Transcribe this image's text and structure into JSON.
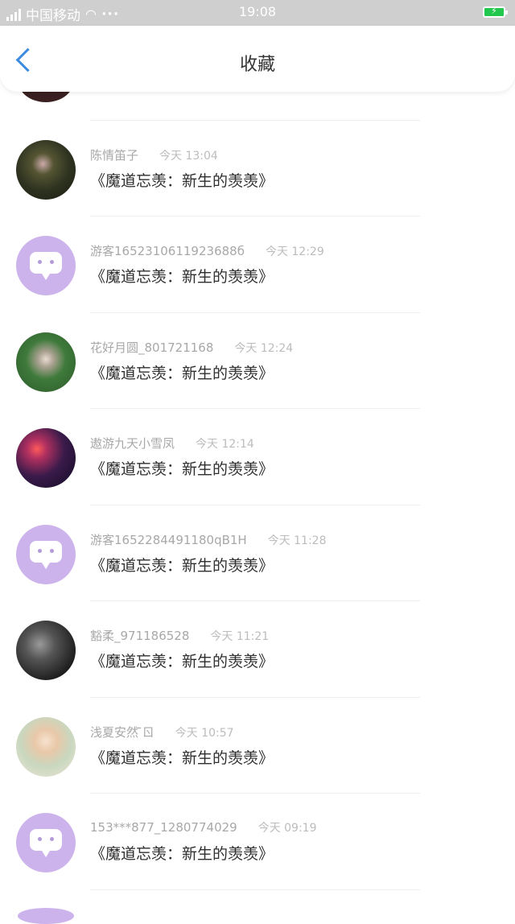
{
  "status_bar": {
    "carrier": "中国移动",
    "time": "19:08",
    "dots": "···",
    "battery_color": "#22c84d"
  },
  "nav": {
    "title": "收藏",
    "back_icon": "chevron-left-icon",
    "accent_color": "#3d8be0"
  },
  "items": [
    {
      "name": "陈情笛子",
      "time": "今天 13:04",
      "message": "《魔道忘羡：新生的羡羡》",
      "avatar": "photo1"
    },
    {
      "name": "游客1652310611923688б",
      "time": "今天 12:29",
      "message": "《魔道忘羡：新生的羡羡》",
      "avatar": "guest"
    },
    {
      "name": "花好月圆_801721168",
      "time": "今天 12:24",
      "message": "《魔道忘羡：新生的羡羡》",
      "avatar": "photo2"
    },
    {
      "name": "遨游九天小雪凤",
      "time": "今天 12:14",
      "message": "《魔道忘羡：新生的羡羡》",
      "avatar": "photo3"
    },
    {
      "name": "游客1652284491180qB1H",
      "time": "今天 11:28",
      "message": "《魔道忘羡：新生的羡羡》",
      "avatar": "guest"
    },
    {
      "name": "豁柔_971186528",
      "time": "今天 11:21",
      "message": "《魔道忘羡：新生的羡羡》",
      "avatar": "photo4"
    },
    {
      "name": "浅夏安然 ̄ㄖ",
      "time": "今天 10:57",
      "message": "《魔道忘羡：新生的羡羡》",
      "avatar": "photo5"
    },
    {
      "name": "153***877_1280774029",
      "time": "今天 09:19",
      "message": "《魔道忘羡：新生的羡羡》",
      "avatar": "guest"
    }
  ]
}
